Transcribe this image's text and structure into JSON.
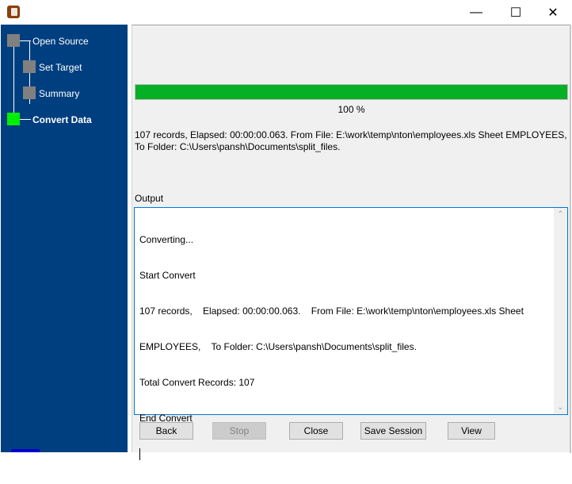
{
  "window": {
    "icon": "app-icon",
    "controls": {
      "minimize": "—",
      "maximize": "☐",
      "close": "✕"
    }
  },
  "sidebar": {
    "steps": [
      {
        "label": "Open Source",
        "state": "done",
        "color": "#808080"
      },
      {
        "label": "Set Target",
        "state": "done",
        "color": "#808080"
      },
      {
        "label": "Summary",
        "state": "done",
        "color": "#808080"
      },
      {
        "label": "Convert Data",
        "state": "active",
        "color": "#00ee00"
      }
    ],
    "background": "#003f7f"
  },
  "progress": {
    "value_percent": 100,
    "label": "100 %",
    "color": "#06b025"
  },
  "status": {
    "line1": "107 records,    Elapsed: 00:00:00.063.    From File: E:\\work\\temp\\nton\\employees.xls Sheet EMPLOYEES,",
    "line2": "To Folder: C:\\Users\\pansh\\Documents\\split_files."
  },
  "output": {
    "label": "Output",
    "lines": [
      "Converting...",
      "Start Convert",
      "107 records,    Elapsed: 00:00:00.063.    From File: E:\\work\\temp\\nton\\employees.xls Sheet",
      "EMPLOYEES,    To Folder: C:\\Users\\pansh\\Documents\\split_files.",
      "Total Convert Records: 107",
      "End Convert"
    ]
  },
  "buttons": {
    "back": "Back",
    "stop": "Stop",
    "close": "Close",
    "save_session": "Save Session",
    "view": "View"
  }
}
